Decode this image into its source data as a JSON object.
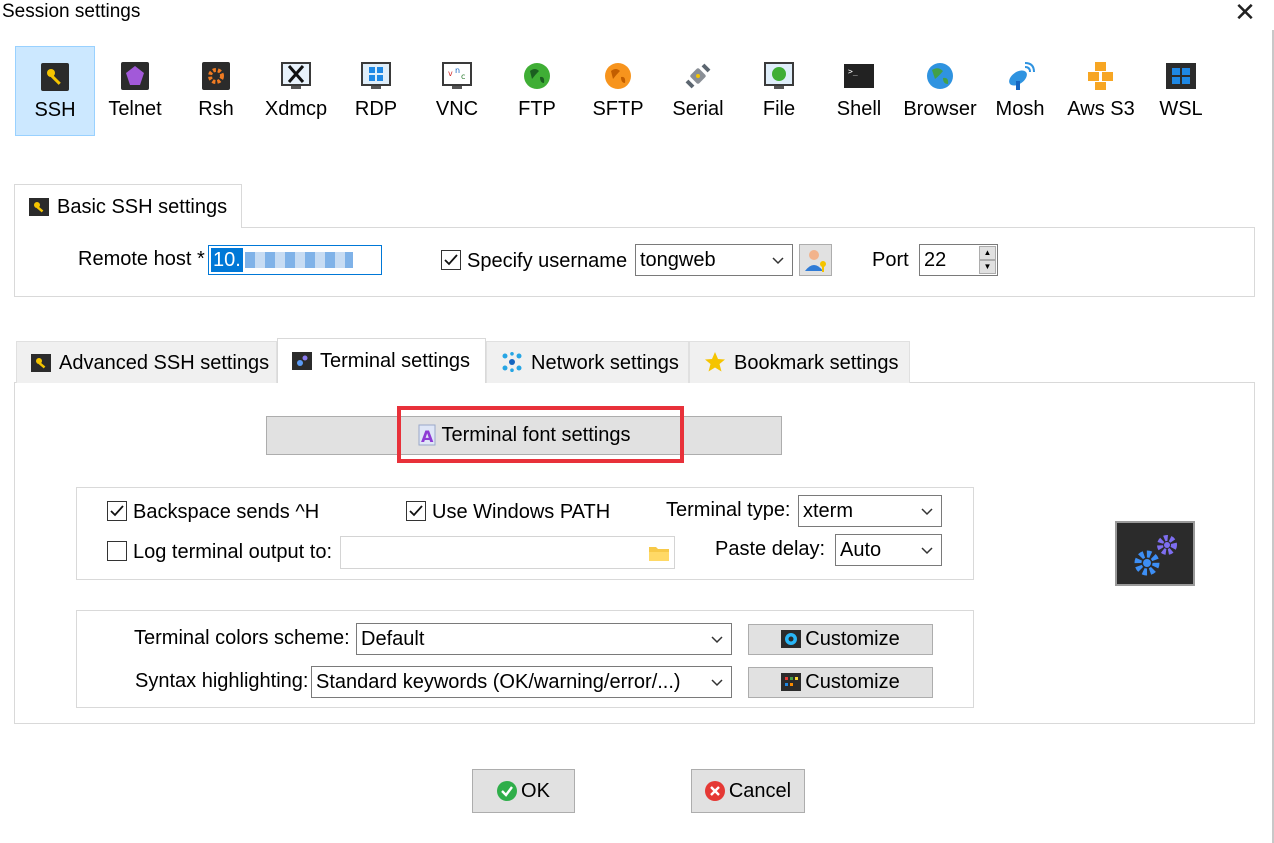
{
  "window": {
    "title": "Session settings"
  },
  "protocols": [
    {
      "label": "SSH",
      "icon": "ssh-key-icon"
    },
    {
      "label": "Telnet",
      "icon": "telnet-gem-icon"
    },
    {
      "label": "Rsh",
      "icon": "rsh-gear-icon"
    },
    {
      "label": "Xdmcp",
      "icon": "xdmcp-x-icon"
    },
    {
      "label": "RDP",
      "icon": "rdp-windows-icon"
    },
    {
      "label": "VNC",
      "icon": "vnc-monitor-icon"
    },
    {
      "label": "FTP",
      "icon": "ftp-globe-icon"
    },
    {
      "label": "SFTP",
      "icon": "sftp-globe-icon"
    },
    {
      "label": "Serial",
      "icon": "serial-plug-icon"
    },
    {
      "label": "File",
      "icon": "file-monitor-icon"
    },
    {
      "label": "Shell",
      "icon": "shell-terminal-icon"
    },
    {
      "label": "Browser",
      "icon": "browser-globe-icon"
    },
    {
      "label": "Mosh",
      "icon": "mosh-satellite-icon"
    },
    {
      "label": "Aws S3",
      "icon": "aws-cubes-icon"
    },
    {
      "label": "WSL",
      "icon": "wsl-windows-icon"
    }
  ],
  "basic": {
    "tab_label": "Basic SSH settings",
    "remote_host_label": "Remote host *",
    "remote_host_value": "10.",
    "specify_username_label": "Specify username",
    "specify_username_checked": true,
    "username_value": "tongweb",
    "port_label": "Port",
    "port_value": "22"
  },
  "tabs": [
    {
      "label": "Advanced SSH settings",
      "icon": "wrench-icon",
      "active": false
    },
    {
      "label": "Terminal settings",
      "icon": "terminal-gear-icon",
      "active": true
    },
    {
      "label": "Network settings",
      "icon": "network-icon",
      "active": false
    },
    {
      "label": "Bookmark settings",
      "icon": "star-icon",
      "active": false
    }
  ],
  "terminal": {
    "font_button_label": "Terminal font settings",
    "backspace_label": "Backspace sends ^H",
    "backspace_checked": true,
    "windows_path_label": "Use Windows PATH",
    "windows_path_checked": true,
    "terminal_type_label": "Terminal type:",
    "terminal_type_value": "xterm",
    "log_output_label": "Log terminal output to:",
    "log_output_checked": false,
    "log_output_value": "",
    "paste_delay_label": "Paste delay:",
    "paste_delay_value": "Auto",
    "colors_scheme_label": "Terminal colors scheme:",
    "colors_scheme_value": "Default",
    "syntax_label": "Syntax highlighting:",
    "syntax_value": "Standard keywords (OK/warning/error/...)",
    "customize_label": "Customize",
    "customize2_label": "Customize"
  },
  "footer": {
    "ok_label": "OK",
    "cancel_label": "Cancel"
  },
  "colors": {
    "selected_bg": "#cce8ff",
    "highlight_box": "#e8313a",
    "ok_green": "#2fae4a",
    "cancel_red": "#e53935"
  }
}
